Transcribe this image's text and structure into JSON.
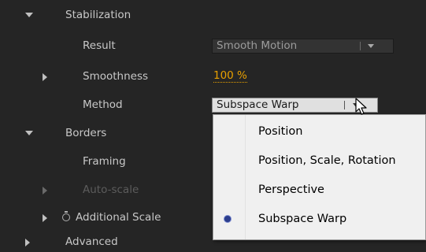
{
  "effect_controls": {
    "stabilization": {
      "label": "Stabilization"
    },
    "result": {
      "label": "Result",
      "value": "Smooth Motion"
    },
    "smoothness": {
      "label": "Smoothness",
      "value": "100 %"
    },
    "method": {
      "label": "Method",
      "value": "Subspace Warp"
    },
    "borders": {
      "label": "Borders"
    },
    "framing": {
      "label": "Framing"
    },
    "auto_scale": {
      "label": "Auto-scale"
    },
    "additional_scale": {
      "label": "Additional Scale"
    },
    "advanced": {
      "label": "Advanced"
    }
  },
  "method_menu": {
    "options": [
      "Position",
      "Position, Scale, Rotation",
      "Perspective",
      "Subspace Warp"
    ],
    "selected": "Subspace Warp"
  },
  "colors": {
    "panel_bg": "#252525",
    "value_link": "#e8a000",
    "menu_bg": "#f0f0f0",
    "selected_bullet": "#2b3d8c"
  }
}
